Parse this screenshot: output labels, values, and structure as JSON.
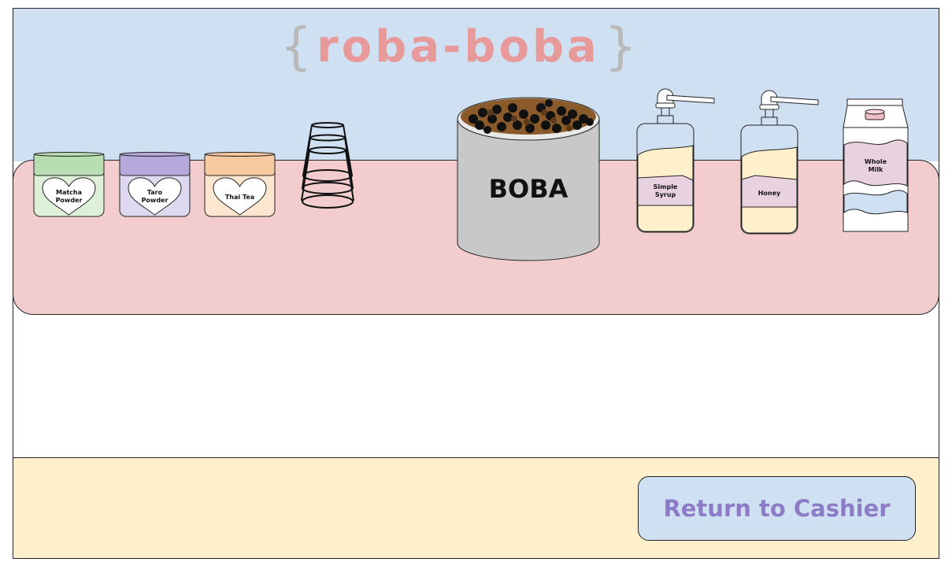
{
  "brand": {
    "brace_open": "{",
    "brace_close": "}",
    "name": "ROBA-BOBA"
  },
  "colors": {
    "sky": "#cfe0f3",
    "counter": "#f3cdcd",
    "floor": "#fff0cc",
    "logo_text": "#e89a9a",
    "logo_brace": "#b9b9b9",
    "button_text": "#8e7bc7"
  },
  "ingredients": {
    "matcha": {
      "line1": "Matcha",
      "line2": "Powder",
      "lid_color": "#b8ddb0",
      "body_color": "#dff0d8"
    },
    "taro": {
      "line1": "Taro",
      "line2": "Powder",
      "lid_color": "#b5a9dc",
      "body_color": "#ded8f0"
    },
    "thai_tea": {
      "line1": "Thai Tea",
      "line2": "",
      "lid_color": "#f7c99e",
      "body_color": "#fde6cf"
    },
    "cups": {
      "icon": "stacked-cups-icon"
    },
    "boba": {
      "label": "BOBA"
    },
    "simple_syrup": {
      "line1": "Simple",
      "line2": "Syrup"
    },
    "honey": {
      "line1": "Honey",
      "line2": ""
    },
    "whole_milk": {
      "line1": "Whole",
      "line2": "Milk"
    }
  },
  "actions": {
    "return_label": "Return to Cashier"
  }
}
